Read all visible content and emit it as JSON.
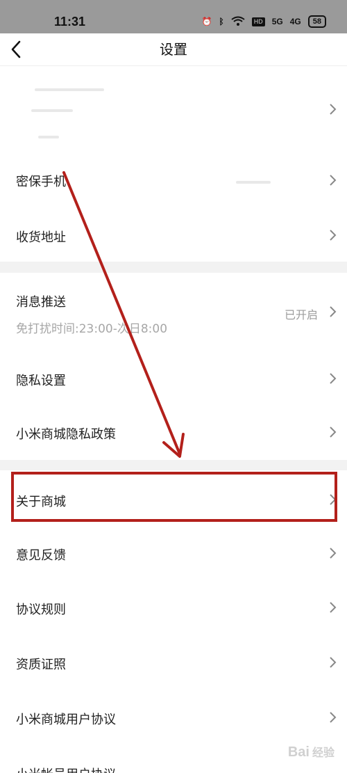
{
  "status_bar": {
    "time": "11:31",
    "icons": [
      "alarm-icon",
      "bluetooth-icon",
      "wifi-icon",
      "hd-icon",
      "signal-5g-icon",
      "signal-4g-icon",
      "battery-icon"
    ],
    "hd_label": "HD",
    "signal1_label": "5G",
    "signal2_label": "4G",
    "battery": "58"
  },
  "header": {
    "title": "设置",
    "back_icon": "chevron-left-icon"
  },
  "settings": {
    "phone": "密保手机",
    "address": "收货地址",
    "push": "消息推送",
    "push_sub": "免打扰时间:23:00-次日8:00",
    "push_value": "已开启",
    "privacy": "隐私设置",
    "privacy_policy": "小米商城隐私政策",
    "about": "关于商城",
    "feedback": "意见反馈",
    "rules": "协议规则",
    "qualification": "资质证照",
    "user_agreement": "小米商城用户协议",
    "account_agreement": "小米帐号用户协议"
  },
  "annotation": {
    "color": "#b3201b",
    "highlighted_item": "关于商城"
  },
  "watermark": {
    "text": "Bai",
    "sub": "经验"
  }
}
